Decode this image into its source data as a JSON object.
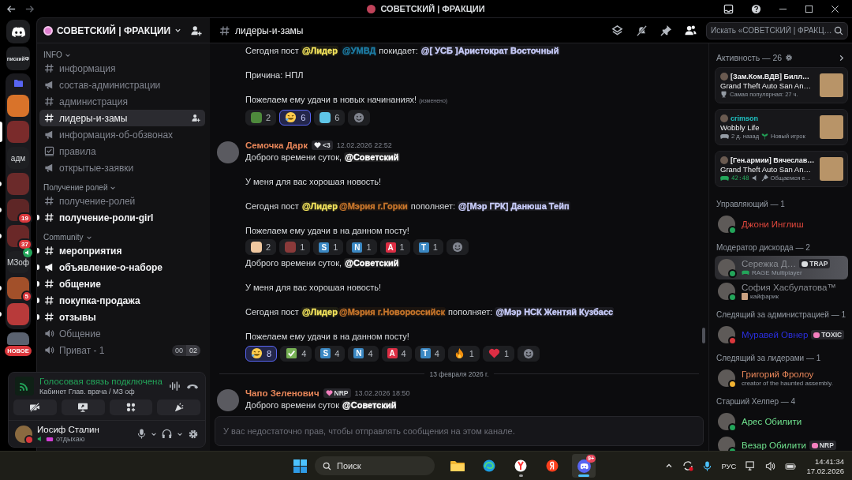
{
  "window": {
    "title": "СОВЕТСКИЙ | ФРАКЦИИ"
  },
  "servers": [
    {
      "kind": "home",
      "selected": false,
      "unread": false
    },
    {
      "kind": "text",
      "label": "пискийФ",
      "selected": false,
      "unread": false
    },
    {
      "kind": "folder",
      "selected": false,
      "unread": false,
      "children": [
        {
          "kind": "avatar",
          "color": "#d9732a",
          "selected": false,
          "unread": false
        },
        {
          "kind": "avatar",
          "color": "#7a2b2b",
          "selected": true,
          "unread": false
        },
        {
          "kind": "text",
          "label": "адм",
          "selected": false,
          "unread": false
        },
        {
          "kind": "avatar",
          "color": "#6b2a2a",
          "selected": false,
          "unread": true
        },
        {
          "kind": "avatar",
          "color": "#5e2626",
          "badge": "19",
          "selected": false,
          "unread": true
        },
        {
          "kind": "avatar",
          "color": "#6a2828",
          "badge": "37",
          "selected": false,
          "unread": true
        },
        {
          "kind": "text",
          "label": "МЗоф",
          "in_voice": true,
          "selected": false,
          "unread": false
        },
        {
          "kind": "avatar",
          "color": "#a2502a",
          "badge": "5",
          "selected": false,
          "unread": true
        },
        {
          "kind": "avatar",
          "color": "#b83a3a",
          "selected": false,
          "unread": true
        }
      ]
    },
    {
      "kind": "avatar",
      "color": "#5a6270",
      "new_label": "НОВОЕ",
      "selected": false,
      "unread": false
    }
  ],
  "server": {
    "name": "СОВЕТСКИЙ | ФРАКЦИИ"
  },
  "categories": [
    {
      "name": "INFO",
      "channels": [
        {
          "kind": "text",
          "name": "информация",
          "selected": false,
          "unread": false
        },
        {
          "kind": "announce",
          "name": "состав-администрации",
          "selected": false,
          "unread": false
        },
        {
          "kind": "text",
          "name": "администрация",
          "selected": false,
          "unread": false
        },
        {
          "kind": "text",
          "name": "лидеры-и-замы",
          "selected": true,
          "unread": false
        },
        {
          "kind": "announce",
          "name": "информация-об-обзвонах",
          "selected": false,
          "unread": false
        },
        {
          "kind": "rules",
          "name": "правила",
          "selected": false,
          "unread": false
        },
        {
          "kind": "announce",
          "name": "открытые-заявки",
          "selected": false,
          "unread": false
        }
      ]
    },
    {
      "name": "Получение ролей",
      "channels": [
        {
          "kind": "text",
          "name": "получение-ролей",
          "selected": false,
          "unread": false
        },
        {
          "kind": "text",
          "name": "получение-роли-girl",
          "selected": false,
          "unread": true
        }
      ]
    },
    {
      "name": "Community",
      "channels": [
        {
          "kind": "text",
          "name": "мероприятия",
          "selected": false,
          "unread": true
        },
        {
          "kind": "announce",
          "name": "объявление-о-наборе",
          "selected": false,
          "unread": true
        },
        {
          "kind": "text",
          "name": "общение",
          "selected": false,
          "unread": true
        },
        {
          "kind": "text",
          "name": "покупка-продажа",
          "selected": false,
          "unread": true
        },
        {
          "kind": "text",
          "name": "отзывы",
          "selected": false,
          "unread": true
        },
        {
          "kind": "voice",
          "name": "Общение",
          "selected": false,
          "unread": false
        },
        {
          "kind": "voice",
          "name": "Приват - 1",
          "selected": false,
          "unread": false,
          "users": "00",
          "limit": "02"
        }
      ]
    }
  ],
  "voice": {
    "status": "Голосовая связь подключена",
    "location": "Кабинет Глав. врача / МЗ оф"
  },
  "user": {
    "name": "Иосиф Сталин",
    "status": "отдыхаю"
  },
  "channel": {
    "name": "лидеры-и-замы"
  },
  "search": {
    "placeholder": "Искать «СОВЕТСКИЙ | ФРАКЦ…"
  },
  "messages": [
    {
      "lines": [
        [
          {
            "kind": "text",
            "text": "Сегодня пост "
          },
          {
            "kind": "mention",
            "text": "@Лидер",
            "color": "#f2e35c",
            "space_after": true
          },
          {
            "kind": "mention",
            "text": "@УМВД",
            "color": "#1e7fa8"
          },
          {
            "kind": "text",
            "text": " покидает: "
          },
          {
            "kind": "mention",
            "text": "@[ УСБ ]Аристократ Восточный",
            "color": "#c9cdfb"
          }
        ],
        [
          {
            "kind": "text",
            "text": "Причина: НПЛ"
          }
        ],
        [
          {
            "kind": "text",
            "text": "Пожелаем ему удачи в новых начинаниях!"
          },
          {
            "kind": "edited",
            "text": "(изменено)"
          }
        ]
      ],
      "reactions": [
        {
          "kind": "picture",
          "color": "#4e8a3c",
          "count": "2",
          "selected": false
        },
        {
          "kind": "laugh",
          "count": "6",
          "selected": true
        },
        {
          "kind": "picture",
          "color": "#5fc6e8",
          "count": "6",
          "selected": false
        },
        {
          "kind": "add",
          "selected": false
        }
      ]
    },
    {
      "author": {
        "name": "Семочка Дарк",
        "color": "#e9875a"
      },
      "tag": {
        "text": "<3",
        "color": "#f2f3f5"
      },
      "time": "12.02.2026 22:52",
      "lines": [
        [
          {
            "kind": "text",
            "text": "Доброго времени суток, "
          },
          {
            "kind": "mention",
            "text": "@Советский",
            "color": "#ffffff"
          }
        ],
        [
          {
            "kind": "text",
            "text": "У меня для вас хорошая новость!"
          }
        ],
        [
          {
            "kind": "text",
            "text": "Сегодня пост "
          },
          {
            "kind": "mention",
            "text": "@Лидер",
            "color": "#f2e35c"
          },
          {
            "kind": "mention",
            "text": "@Мэрия г.Горки",
            "color": "#c6752b"
          },
          {
            "kind": "text",
            "text": "  пополняет: "
          },
          {
            "kind": "mention",
            "text": "@[Мэр ГРК] Данюша Тейп",
            "color": "#c9cdfb"
          }
        ],
        [
          {
            "kind": "text",
            "text": "Пожелаем ему удачи в на данном посту!"
          }
        ]
      ],
      "reactions": [
        {
          "kind": "picture",
          "color": "#f0c8a0",
          "count": "2",
          "selected": false
        },
        {
          "kind": "picture",
          "color": "#8a3a3a",
          "count": "1",
          "selected": false
        },
        {
          "kind": "letter",
          "label": "S",
          "color": "#3b88c3",
          "count": "1",
          "selected": false
        },
        {
          "kind": "letter",
          "label": "N",
          "color": "#3b88c3",
          "count": "1",
          "selected": false
        },
        {
          "kind": "letter",
          "label": "A",
          "color": "#dd2e44",
          "count": "1",
          "selected": false
        },
        {
          "kind": "letter",
          "label": "T",
          "color": "#3b88c3",
          "count": "1",
          "selected": false
        },
        {
          "kind": "add",
          "selected": false
        }
      ]
    },
    {
      "lines": [
        [
          {
            "kind": "text",
            "text": "Доброго времени суток, "
          },
          {
            "kind": "mention",
            "text": "@Советский",
            "color": "#ffffff"
          }
        ],
        [
          {
            "kind": "text",
            "text": "У меня для вас хорошая новость!"
          }
        ],
        [
          {
            "kind": "text",
            "text": "Сегодня пост "
          },
          {
            "kind": "mention",
            "text": "@Лидер",
            "color": "#f2e35c"
          },
          {
            "kind": "mention",
            "text": "@Мэрия г.Новороссийск",
            "color": "#c6752b"
          },
          {
            "kind": "text",
            "text": " пополняет: "
          },
          {
            "kind": "mention",
            "text": "@Мэр НСК Жентяй Кузбасс",
            "color": "#c9cdfb"
          }
        ],
        [
          {
            "kind": "text",
            "text": "Пожелаем ему удачи в на данном посту!"
          }
        ]
      ],
      "reactions": [
        {
          "kind": "laugh",
          "count": "8",
          "selected": true
        },
        {
          "kind": "check",
          "count": "4",
          "selected": false
        },
        {
          "kind": "letter",
          "label": "S",
          "color": "#3b88c3",
          "count": "4",
          "selected": false
        },
        {
          "kind": "letter",
          "label": "N",
          "color": "#3b88c3",
          "count": "4",
          "selected": false
        },
        {
          "kind": "letter",
          "label": "A",
          "color": "#dd2e44",
          "count": "4",
          "selected": false
        },
        {
          "kind": "letter",
          "label": "T",
          "color": "#3b88c3",
          "count": "4",
          "selected": false
        },
        {
          "kind": "fire",
          "count": "1",
          "selected": false
        },
        {
          "kind": "heart",
          "count": "1",
          "selected": false
        },
        {
          "kind": "add",
          "selected": false
        }
      ]
    },
    {
      "divider": "13 февраля 2026 г."
    },
    {
      "author": {
        "name": "Чапо Зеленович",
        "color": "#e9875a"
      },
      "tag": {
        "text": "NRP",
        "color": "#f47fbf"
      },
      "time": "13.02.2026 18:50",
      "lines": [
        [
          {
            "kind": "text",
            "text": "Доброго времени суток "
          },
          {
            "kind": "mention",
            "text": "@Советский",
            "color": "#ffffff"
          }
        ]
      ]
    }
  ],
  "composer": {
    "placeholder": "У вас недостаточно прав, чтобы отправлять сообщения на этом канале."
  },
  "activity": {
    "title": "Активность — 26",
    "cards": [
      {
        "title": "[Зам.Ком.ВДВ] Билл…",
        "color": "#f2f3f5",
        "game": "Grand Theft Auto San An…",
        "details": [
          {
            "kind": "trophy",
            "text": "Самая популярная: 27 ч."
          }
        ]
      },
      {
        "title": "crimson",
        "color": "#1fc4c4",
        "game": "Wobbly Life",
        "details": [
          {
            "kind": "controller",
            "text": "2 д. назад"
          },
          {
            "kind": "sprout",
            "text": "Новый игрок"
          }
        ]
      },
      {
        "title": "[Ген.армии] Вячеслав…",
        "color": "#f2f3f5",
        "game": "Grand Theft Auto San An…",
        "details": [
          {
            "kind": "timer",
            "text": "42:48"
          },
          {
            "kind": "speaker"
          },
          {
            "kind": "mic",
            "text": "Общаемся е…"
          }
        ]
      }
    ]
  },
  "member_groups": [
    {
      "title": "Управляющий — 1",
      "members": [
        {
          "name": "Джони Инглиш",
          "color": "#e0473c",
          "status": {
            "kind": "online"
          },
          "highlighted": false
        }
      ]
    },
    {
      "title": "Модератор дискорда — 2",
      "members": [
        {
          "name": "Сережка Д…",
          "color": "#8a8d93",
          "status": {
            "kind": "online"
          },
          "tag": {
            "text": "TRAP",
            "color": "#dbdee1"
          },
          "activity": {
            "kind": "game",
            "text": "RAGE Multiplayer"
          },
          "highlighted": true
        },
        {
          "name": "София Хасбулатова™",
          "color": "#8a8d93",
          "status": {
            "kind": "online"
          },
          "activity": {
            "kind": "picture",
            "text": "кайфарик"
          },
          "highlighted": false
        }
      ]
    },
    {
      "title": "Следящий за администрацией — 1",
      "members": [
        {
          "name": "Муравей Овнер",
          "color": "#2b2fe0",
          "status": {
            "kind": "dnd"
          },
          "tag": {
            "text": "TOXIC",
            "color": "#f47fbf"
          },
          "highlighted": false
        }
      ]
    },
    {
      "title": "Следящий за лидерами — 1",
      "members": [
        {
          "name": "Григорий Фролоу",
          "color": "#e9875a",
          "status": {
            "kind": "idle"
          },
          "activity": {
            "kind": "text",
            "text": "creator of the haunted assembly."
          },
          "highlighted": false
        }
      ]
    },
    {
      "title": "Старший Хелпер — 4",
      "members": [
        {
          "name": "Арес Обилити",
          "color": "#6fe08d",
          "status": {
            "kind": "online"
          },
          "highlighted": false
        },
        {
          "name": "Везар Обилити",
          "color": "#6fe08d",
          "status": {
            "kind": "online"
          },
          "tag": {
            "text": "NRP",
            "color": "#f47fbf"
          },
          "highlighted": false
        }
      ]
    }
  ],
  "taskbar": {
    "search": {
      "placeholder": "Поиск"
    },
    "apps": [
      {
        "kind": "files",
        "selected": false,
        "running": false
      },
      {
        "kind": "edge",
        "selected": false,
        "running": false
      },
      {
        "kind": "ybrowser",
        "selected": false,
        "running": true
      },
      {
        "kind": "yandex",
        "selected": false,
        "running": false
      },
      {
        "kind": "discord",
        "selected": true,
        "running": true,
        "badge": "9+"
      }
    ],
    "language": "РУС",
    "time": "14:41:34",
    "date": "17.02.2026"
  }
}
